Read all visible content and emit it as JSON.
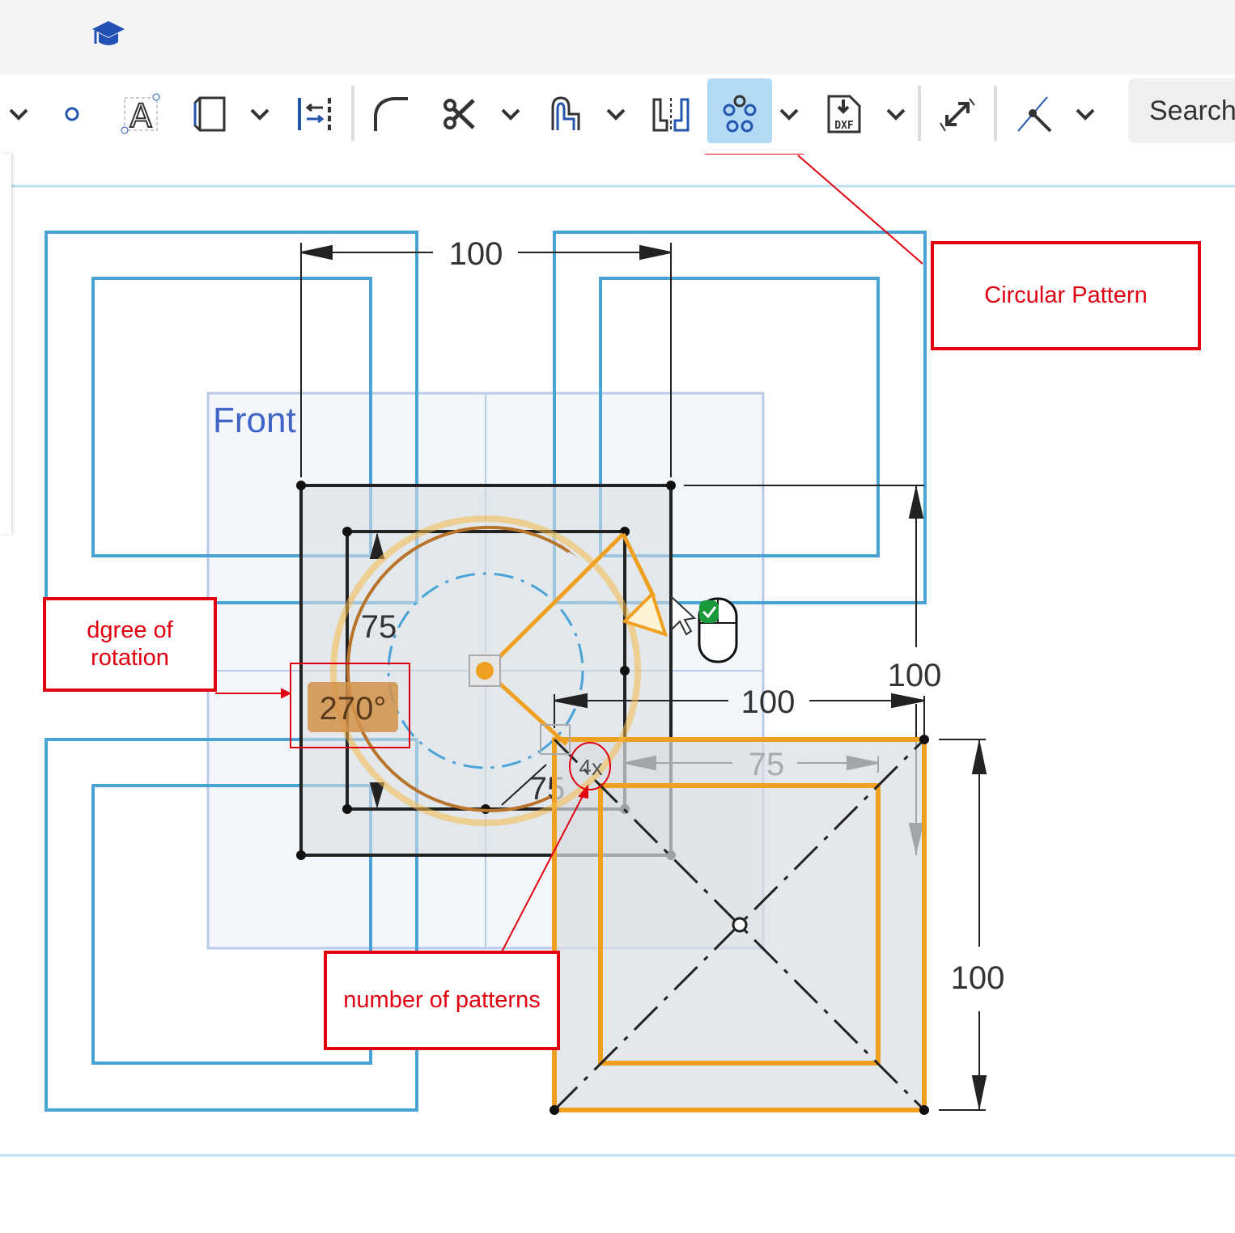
{
  "header": {
    "logo_icon": "graduation-cap-icon"
  },
  "toolbar": {
    "tools": [
      {
        "name": "dropdown",
        "icon": "chevron-down-icon"
      },
      {
        "name": "point",
        "icon": "point-icon"
      },
      {
        "name": "text",
        "icon": "text-icon"
      },
      {
        "name": "use",
        "icon": "use-icon"
      },
      {
        "name": "offset",
        "icon": "offset-icon"
      },
      {
        "name": "fillet",
        "icon": "fillet-icon"
      },
      {
        "name": "trim",
        "icon": "scissors-icon"
      },
      {
        "name": "offset-curve",
        "icon": "offset-curve-icon"
      },
      {
        "name": "mirror",
        "icon": "mirror-icon"
      },
      {
        "name": "circular-pattern",
        "icon": "circular-pattern-icon",
        "active": true
      },
      {
        "name": "dxf-import",
        "icon": "dxf-icon",
        "label": "DXF"
      },
      {
        "name": "transform",
        "icon": "transform-icon"
      },
      {
        "name": "intersect",
        "icon": "intersect-icon"
      }
    ],
    "search_label": "Search"
  },
  "canvas": {
    "plane_label": "Front",
    "dimensions": {
      "top_width": "100",
      "right_height": "100",
      "inner_width": "100",
      "inner_75_left": "75",
      "inner_75_right": "75",
      "inner_75_bottom": "75",
      "copy_height": "100"
    },
    "rotation_value": "270°",
    "pattern_count": "4x",
    "colors": {
      "sketch_blue": "#4aa3d6",
      "selection_orange": "#f0a020",
      "annotation_red": "#e0000f"
    }
  },
  "annotations": {
    "circular_pattern": "Circular Pattern",
    "degree_of_rotation": "dgree of rotation",
    "number_of_patterns": "number of patterns"
  }
}
